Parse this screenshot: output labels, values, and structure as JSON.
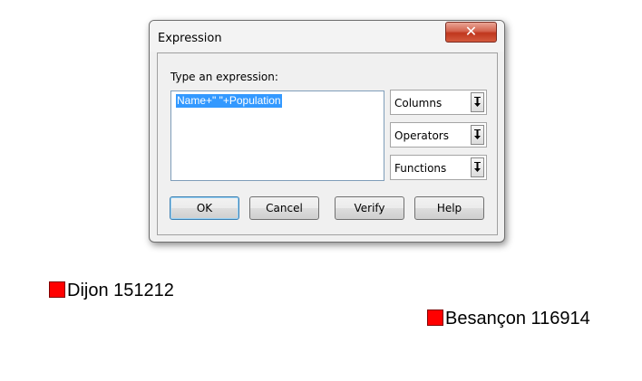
{
  "dialog": {
    "title": "Expression",
    "close_label": "✕",
    "prompt_label": "Type an expression:",
    "expression_value": "Name+\" \"+Population",
    "dropdowns": [
      {
        "label": "Columns"
      },
      {
        "label": "Operators"
      },
      {
        "label": "Functions"
      }
    ],
    "buttons": {
      "ok": "OK",
      "cancel": "Cancel",
      "verify": "Verify",
      "help": "Help"
    }
  },
  "map_labels": [
    {
      "text": "Dijon 151212",
      "color": "#ff0000"
    },
    {
      "text": "Besançon 116914",
      "color": "#ff0000"
    }
  ],
  "colors": {
    "accent": "#3399ff",
    "close_button": "#c0361d"
  }
}
